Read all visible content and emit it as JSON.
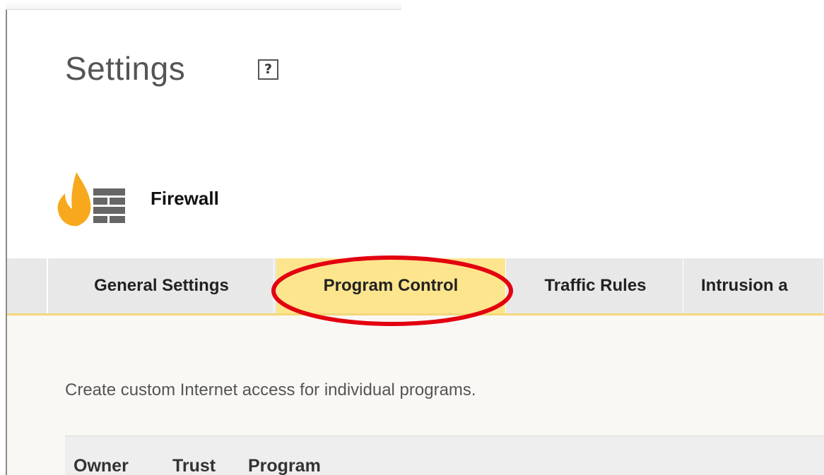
{
  "header": {
    "title": "Settings",
    "help_label": "?"
  },
  "product": {
    "name": "Firewall",
    "icon": "firewall-icon"
  },
  "tabs": [
    {
      "label": "General Settings",
      "active": false
    },
    {
      "label": "Program Control",
      "active": true
    },
    {
      "label": "Traffic Rules",
      "active": false
    },
    {
      "label": "Intrusion a",
      "active": false
    }
  ],
  "content": {
    "description": "Create custom Internet access for individual programs.",
    "table": {
      "columns": [
        "Owner",
        "Trust",
        "Program"
      ]
    }
  },
  "colors": {
    "active_tab": "#fde58e",
    "tab_underline": "#f5d77a",
    "flame": "#f7a81c",
    "wall": "#666666",
    "annotation": "#e3000f"
  }
}
